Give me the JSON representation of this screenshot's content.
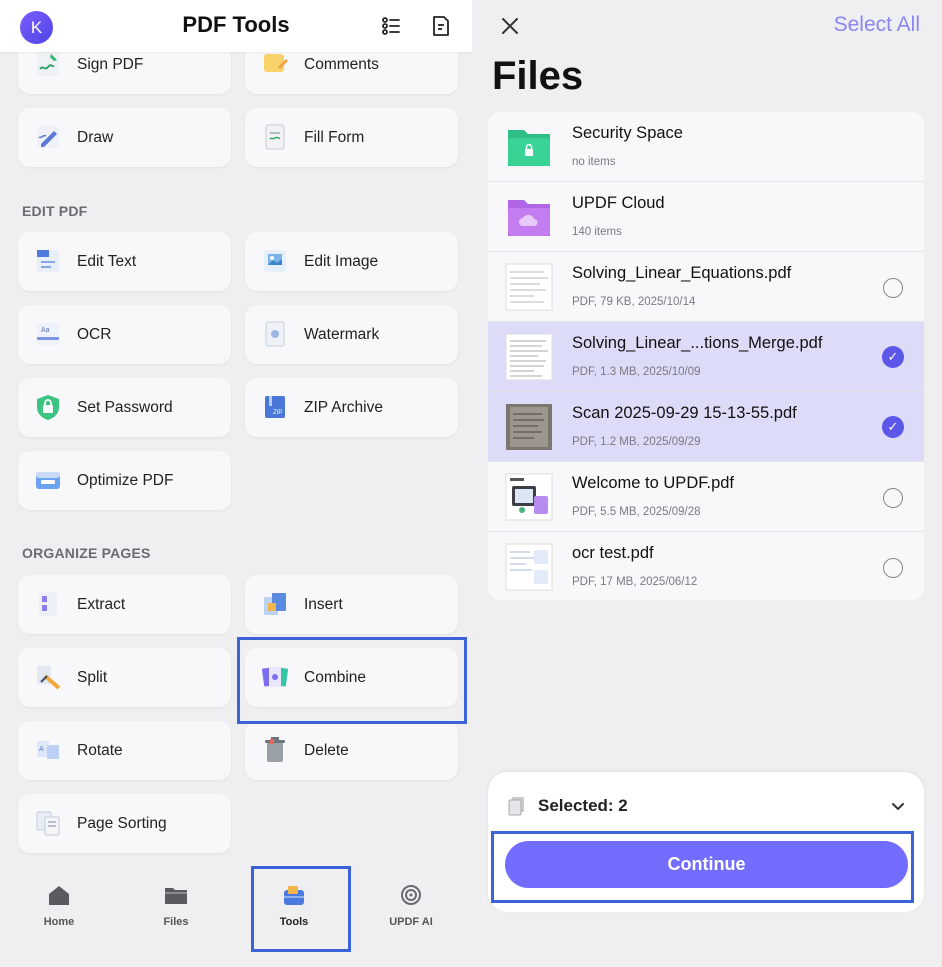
{
  "left": {
    "avatar_letter": "K",
    "title": "PDF Tools",
    "top_tiles": [
      "Sign PDF",
      "Comments",
      "Draw",
      "Fill Form"
    ],
    "edit_section": "EDIT PDF",
    "edit_tiles": [
      "Edit Text",
      "Edit Image",
      "OCR",
      "Watermark",
      "Set Password",
      "ZIP Archive",
      "Optimize PDF"
    ],
    "organize_section": "ORGANIZE PAGES",
    "organize_tiles": [
      "Extract",
      "Insert",
      "Split",
      "Combine",
      "Rotate",
      "Delete",
      "Page Sorting"
    ],
    "nav": [
      "Home",
      "Files",
      "Tools",
      "UPDF AI"
    ],
    "active_nav": "Tools",
    "highlighted_tool": "Combine"
  },
  "right": {
    "select_all": "Select All",
    "title": "Files",
    "files": [
      {
        "name": "Security Space",
        "meta": "no items",
        "kind": "folder",
        "selected": null
      },
      {
        "name": "UPDF Cloud",
        "meta": "140 items",
        "kind": "folder",
        "selected": null
      },
      {
        "name": "Solving_Linear_Equations.pdf",
        "meta": "PDF, 79 KB, 2025/10/14",
        "kind": "pdf",
        "selected": false
      },
      {
        "name": "Solving_Linear_...tions_Merge.pdf",
        "meta": "PDF, 1.3 MB, 2025/10/09",
        "kind": "pdf",
        "selected": true
      },
      {
        "name": "Scan 2025-09-29 15-13-55.pdf",
        "meta": "PDF, 1.2 MB, 2025/09/29",
        "kind": "scan",
        "selected": true
      },
      {
        "name": "Welcome to UPDF.pdf",
        "meta": "PDF, 5.5 MB, 2025/09/28",
        "kind": "pdf",
        "selected": false
      },
      {
        "name": "ocr test.pdf",
        "meta": "PDF, 17 MB, 2025/06/12",
        "kind": "pdf",
        "selected": false
      }
    ],
    "selected_label": "Selected: 2",
    "continue_label": "Continue"
  },
  "colors": {
    "accent": "#736dff",
    "highlight_border": "#3b63d9",
    "select_all": "#8a86f2"
  }
}
